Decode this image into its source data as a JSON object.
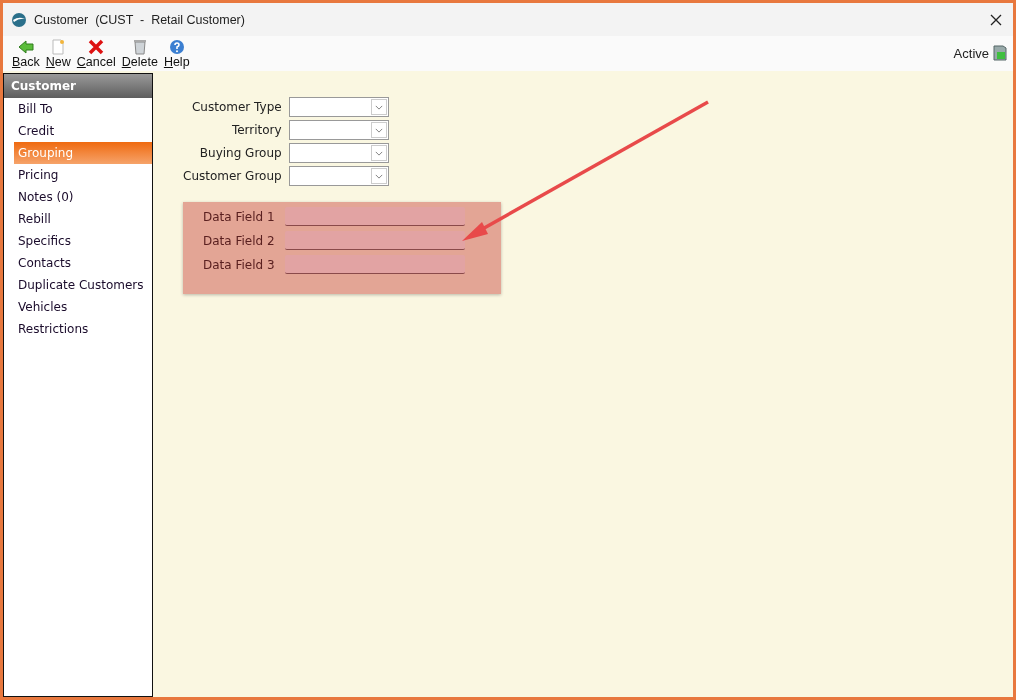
{
  "window": {
    "title": "Customer  (CUST  -  Retail Customer)"
  },
  "toolbar": [
    {
      "kind": "back",
      "label": "Back"
    },
    {
      "kind": "new",
      "label": "New"
    },
    {
      "kind": "cancel",
      "label": "Cancel"
    },
    {
      "kind": "delete",
      "label": "Delete"
    },
    {
      "kind": "help",
      "label": "Help"
    }
  ],
  "status": {
    "label": "Active"
  },
  "sidebar": {
    "header": "Customer",
    "items": [
      {
        "label": "Bill To",
        "selected": false
      },
      {
        "label": "Credit",
        "selected": false
      },
      {
        "label": "Grouping",
        "selected": true
      },
      {
        "label": "Pricing",
        "selected": false
      },
      {
        "label": "Notes (0)",
        "selected": false
      },
      {
        "label": "Rebill",
        "selected": false
      },
      {
        "label": "Specifics",
        "selected": false
      },
      {
        "label": "Contacts",
        "selected": false
      },
      {
        "label": "Duplicate Customers",
        "selected": false
      },
      {
        "label": "Vehicles",
        "selected": false
      },
      {
        "label": "Restrictions",
        "selected": false
      }
    ]
  },
  "dropdowns": [
    {
      "label": "Customer Type"
    },
    {
      "label": "Territory"
    },
    {
      "label": "Buying Group"
    },
    {
      "label": "Customer Group"
    }
  ],
  "data_fields": [
    {
      "label": "Data Field 1"
    },
    {
      "label": "Data Field 2"
    },
    {
      "label": "Data Field 3"
    }
  ]
}
